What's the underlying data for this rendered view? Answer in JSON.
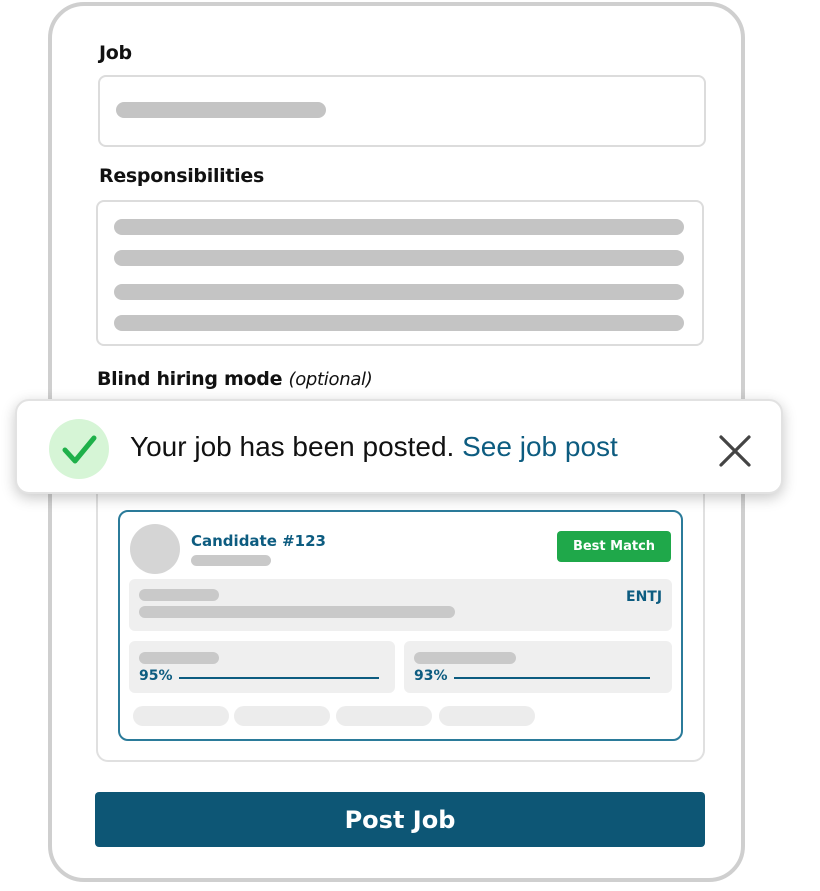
{
  "form": {
    "job_label": "Job",
    "responsibilities_label": "Responsibilities",
    "blind_label": "Blind hiring mode",
    "blind_optional": "(optional)"
  },
  "toast": {
    "message": "Your job has been posted.",
    "link": "See job post",
    "icons": {
      "status": "check-icon",
      "close": "close-icon"
    },
    "colors": {
      "check": "#1fb04a",
      "check_bg": "#d6f5d6",
      "link": "#0d5c80"
    }
  },
  "candidate": {
    "name": "Candidate  #123",
    "badge": "Best Match",
    "type": "ENTJ",
    "metric_1": "95%",
    "metric_2": "93%",
    "colors": {
      "badge": "#1fa84a",
      "accent": "#0d5c80"
    }
  },
  "actions": {
    "post_label": "Post Job",
    "color": "#0d5675"
  }
}
